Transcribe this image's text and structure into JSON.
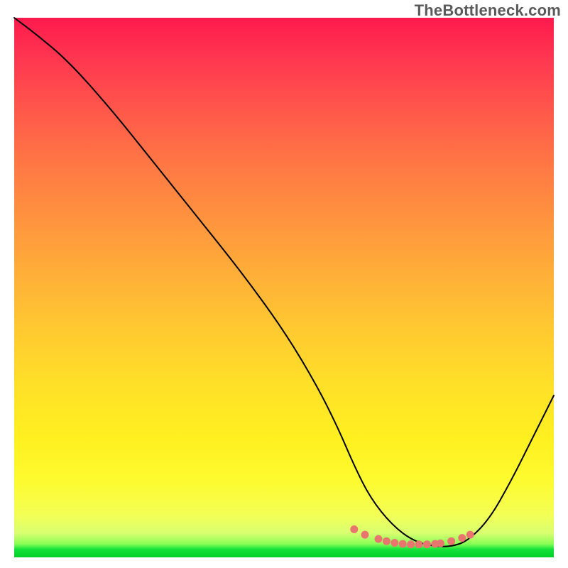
{
  "watermark": "TheBottleneck.com",
  "chart_data": {
    "type": "line",
    "title": "",
    "xlabel": "",
    "ylabel": "",
    "xlim": [
      0,
      100
    ],
    "ylim": [
      0,
      100
    ],
    "grid": false,
    "legend": false,
    "series": [
      {
        "name": "curve",
        "x": [
          0,
          4,
          10,
          18,
          26,
          34,
          42,
          50,
          56,
          60,
          63,
          66,
          70,
          74,
          78,
          81,
          84,
          88,
          92,
          96,
          100
        ],
        "y": [
          100,
          97,
          92,
          83,
          73,
          63,
          53,
          42,
          32,
          24,
          17,
          11,
          6,
          3,
          2,
          2,
          3,
          7,
          14,
          22,
          30
        ]
      }
    ],
    "markers": {
      "name": "bottom-dots",
      "x": [
        63,
        65,
        67.5,
        69,
        70.5,
        72,
        73.5,
        75,
        76.5,
        78,
        79,
        81,
        83,
        84.5
      ],
      "y": [
        5.2,
        4.2,
        3.4,
        3.0,
        2.7,
        2.5,
        2.4,
        2.4,
        2.4,
        2.5,
        2.6,
        3.0,
        3.6,
        4.2
      ]
    }
  }
}
